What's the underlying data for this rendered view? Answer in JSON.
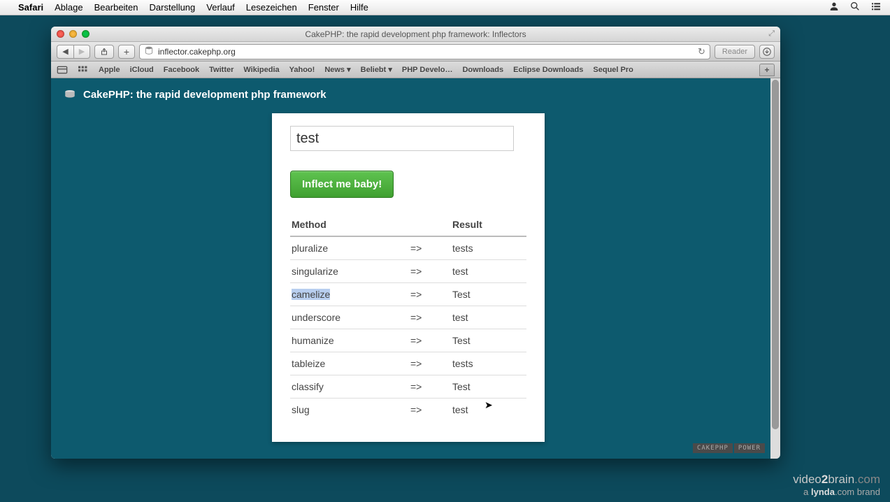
{
  "menubar": {
    "app": "Safari",
    "items": [
      "Ablage",
      "Bearbeiten",
      "Darstellung",
      "Verlauf",
      "Lesezeichen",
      "Fenster",
      "Hilfe"
    ]
  },
  "window": {
    "title": "CakePHP: the rapid development php framework: Inflectors",
    "url": "inflector.cakephp.org",
    "reader": "Reader"
  },
  "bookmarks": [
    "Apple",
    "iCloud",
    "Facebook",
    "Twitter",
    "Wikipedia",
    "Yahoo!",
    "News ▾",
    "Beliebt ▾",
    "PHP Develo…",
    "Downloads",
    "Eclipse Downloads",
    "Sequel Pro"
  ],
  "page": {
    "heading": "CakePHP: the rapid development php framework",
    "input_value": "test",
    "button": "Inflect me baby!",
    "col_method": "Method",
    "col_result": "Result",
    "arrow": "=>",
    "rows": [
      {
        "method": "pluralize",
        "result": "tests",
        "hl": false
      },
      {
        "method": "singularize",
        "result": "test",
        "hl": false
      },
      {
        "method": "camelize",
        "result": "Test",
        "hl": true
      },
      {
        "method": "underscore",
        "result": "test",
        "hl": false
      },
      {
        "method": "humanize",
        "result": "Test",
        "hl": false
      },
      {
        "method": "tableize",
        "result": "tests",
        "hl": false
      },
      {
        "method": "classify",
        "result": "Test",
        "hl": false
      },
      {
        "method": "slug",
        "result": "test",
        "hl": false
      }
    ],
    "badge1": "CAKEPHP",
    "badge2": "POWER"
  },
  "watermark": {
    "line1a": "video",
    "line1b": "2",
    "line1c": "brain",
    "line1d": ".com",
    "line2a": "a ",
    "line2b": "lynda",
    "line2c": ".com brand"
  }
}
